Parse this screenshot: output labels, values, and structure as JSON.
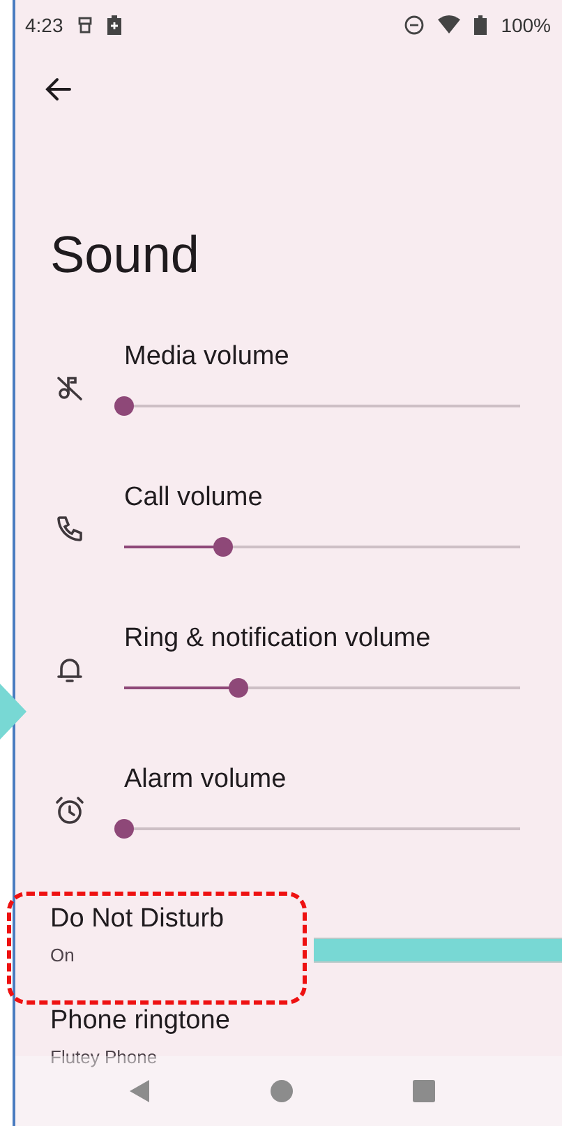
{
  "status_bar": {
    "time": "4:23",
    "battery": "100%"
  },
  "title": "Sound",
  "volumes": [
    {
      "kind": "media",
      "label": "Media volume",
      "level": 0
    },
    {
      "kind": "call",
      "label": "Call volume",
      "level": 0.25
    },
    {
      "kind": "ring",
      "label": "Ring & notification volume",
      "level": 0.29
    },
    {
      "kind": "alarm",
      "label": "Alarm volume",
      "level": 0
    }
  ],
  "do_not_disturb": {
    "title": "Do Not Disturb",
    "summary": "On"
  },
  "phone_ringtone": {
    "title": "Phone ringtone",
    "summary": "Flutey Phone"
  }
}
